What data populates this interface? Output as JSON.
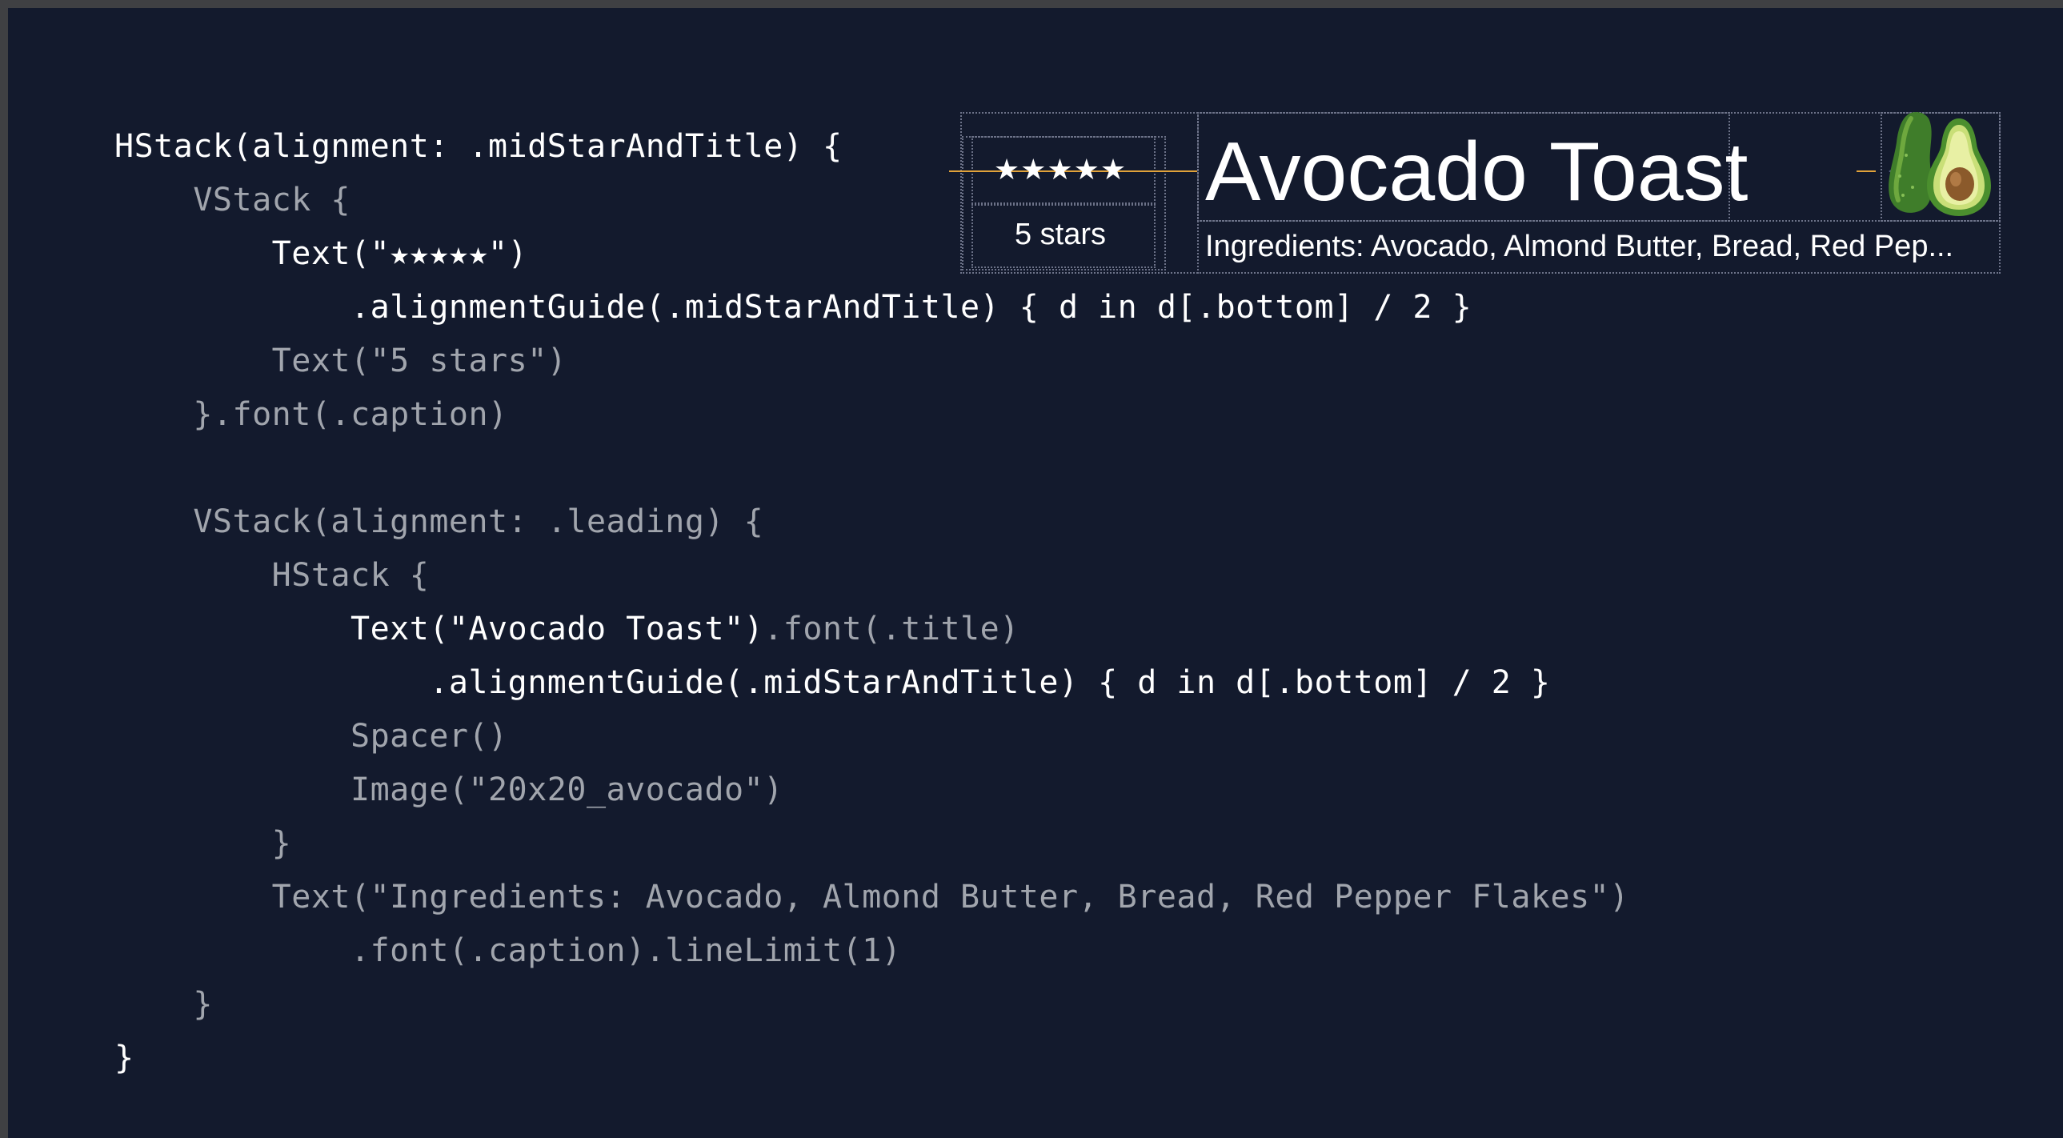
{
  "code_lines": [
    {
      "text": "HStack(alignment: .midStarAndTitle) {",
      "tone": "hi"
    },
    {
      "text": "    VStack {",
      "tone": "dim"
    },
    {
      "text": "        Text(\"★★★★★\")",
      "tone": "hi"
    },
    {
      "text": "            .alignmentGuide(.midStarAndTitle) { d in d[.bottom] / 2 }",
      "tone": "hi"
    },
    {
      "text": "        Text(\"5 stars\")",
      "tone": "dim"
    },
    {
      "text": "    }.font(.caption)",
      "tone": "dim"
    },
    {
      "text": "",
      "tone": "dim"
    },
    {
      "text": "    VStack(alignment: .leading) {",
      "tone": "dim"
    },
    {
      "text": "        HStack {",
      "tone": "dim"
    },
    {
      "text_hi": "            Text(\"Avocado Toast\")",
      "text_dim": ".font(.title)",
      "tone": "mixed"
    },
    {
      "text": "                .alignmentGuide(.midStarAndTitle) { d in d[.bottom] / 2 }",
      "tone": "hi"
    },
    {
      "text": "            Spacer()",
      "tone": "dim"
    },
    {
      "text": "            Image(\"20x20_avocado\")",
      "tone": "dim"
    },
    {
      "text": "        }",
      "tone": "dim"
    },
    {
      "text": "        Text(\"Ingredients: Avocado, Almond Butter, Bread, Red Pepper Flakes\")",
      "tone": "dim"
    },
    {
      "text": "            .font(.caption).lineLimit(1)",
      "tone": "dim"
    },
    {
      "text": "    }",
      "tone": "dim"
    },
    {
      "text": "}",
      "tone": "hi"
    }
  ],
  "preview": {
    "stars": "★★★★★",
    "stars_caption": "5 stars",
    "title": "Avocado Toast",
    "ingredients": "Ingredients: Avocado, Almond Butter, Bread, Red Pep...",
    "image_icon": "avocado-icon"
  },
  "colors": {
    "background": "#131a2d",
    "code_primary": "#ffffff",
    "code_secondary": "#a1a5ad",
    "alignment_guide": "#e1a23a",
    "layout_outline": "#6c7288"
  }
}
